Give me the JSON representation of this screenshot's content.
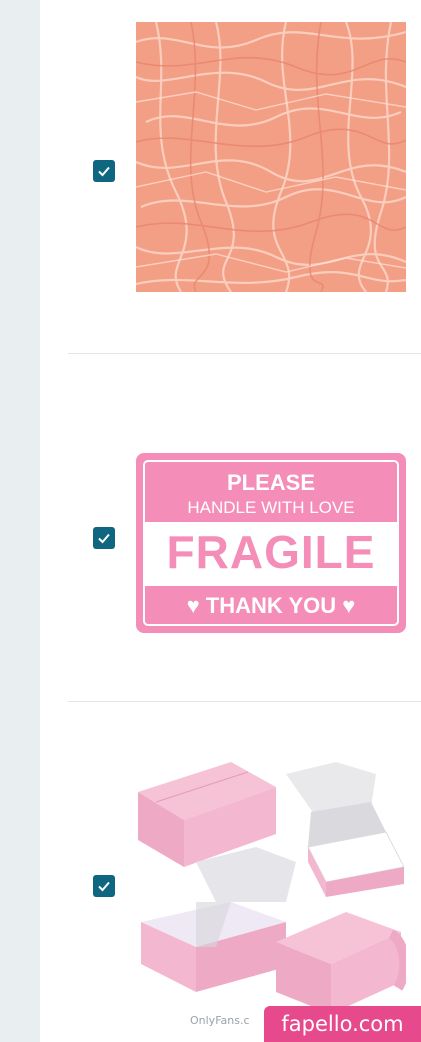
{
  "items": [
    {
      "name": "shredded-paper-filler",
      "checked": true,
      "color": "#f6a98f"
    },
    {
      "name": "fragile-sticker",
      "checked": true,
      "color": "#f48db8",
      "label": {
        "line1": "PLEASE",
        "line2": "HANDLE WITH LOVE",
        "big": "FRAGILE",
        "line4": "♥ THANK YOU ♥"
      }
    },
    {
      "name": "pink-mailer-boxes",
      "checked": true,
      "color": "#f3b8cf"
    }
  ],
  "watermark": {
    "site": "OnlyFans.c",
    "badge": "fapello.com"
  },
  "colors": {
    "checkbox": "#0f6680",
    "sidebar": "#e9eef0",
    "badge": "#e64a8c"
  }
}
